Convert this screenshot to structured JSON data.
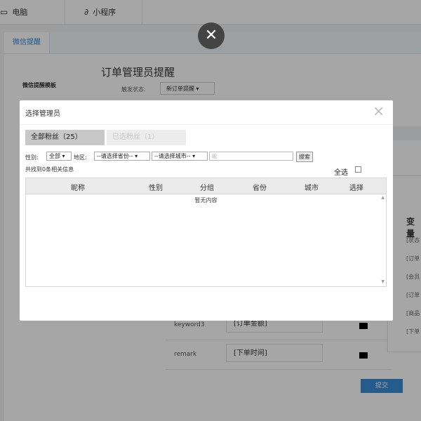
{
  "topbar": {
    "tabs": [
      {
        "label": "电脑",
        "icon": "monitor-icon"
      },
      {
        "label": "小程序",
        "icon": "link-icon"
      }
    ]
  },
  "page": {
    "tab_label": "微信提醒",
    "title": "订单管理员提醒",
    "side_label": "微信提醒模板",
    "trigger_label": "触发状态:",
    "trigger_value": "新订单提醒",
    "variables_title": "变量",
    "variables": [
      "[状态",
      "[订单",
      "[会员",
      "[订单",
      "[商品",
      "[下单"
    ],
    "rows": [
      {
        "key": "keyword3",
        "value": "[订单金额]"
      },
      {
        "key": "remark",
        "value": "[下单时间]"
      }
    ],
    "submit_label": "提交"
  },
  "close_overlay_glyph": "✕",
  "modal": {
    "title": "选择管理员",
    "close_glyph": "×",
    "tabs": {
      "all": "全部粉丝（25）",
      "selected": "已选粉丝（1）"
    },
    "filters": {
      "gender_label": "性别:",
      "gender_value": "全部",
      "region_label": "地区:",
      "province_value": "--请选择省份--",
      "city_value": "--请选择城市--",
      "keyword_placeholder": "昵",
      "search_label": "搜索"
    },
    "count_text": "共找到0条相关信息",
    "select_all_label": "全选",
    "columns": [
      "昵称",
      "性别",
      "分组",
      "省份",
      "城市",
      "选择"
    ],
    "empty_text": "暂无内容"
  }
}
